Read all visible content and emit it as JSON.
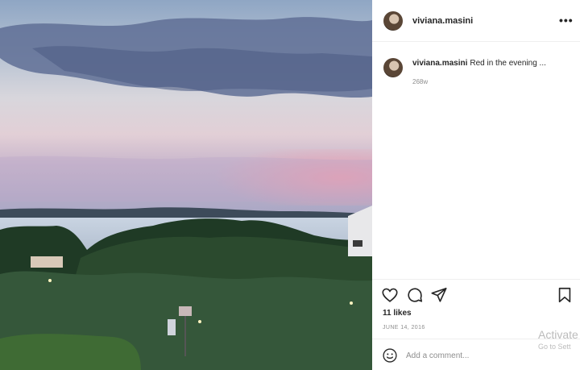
{
  "post": {
    "username": "viviana.masini",
    "more_label": "•••",
    "caption_username": "viviana.masini",
    "caption_text": "Red in the evening ...",
    "time_ago": "268w",
    "likes": "11 likes",
    "date": "JUNE 14, 2016"
  },
  "comment": {
    "placeholder": "Add a comment..."
  },
  "icons": {
    "heart": "heart-icon",
    "comment": "comment-icon",
    "share": "share-icon",
    "save": "bookmark-icon",
    "emoji": "emoji-icon",
    "more": "more-icon"
  },
  "watermark": {
    "title": "Activate",
    "subtitle": "Go to Sett"
  },
  "colors": {
    "text": "#262626",
    "secondary": "#8e8e8e",
    "divider": "#efefef"
  }
}
